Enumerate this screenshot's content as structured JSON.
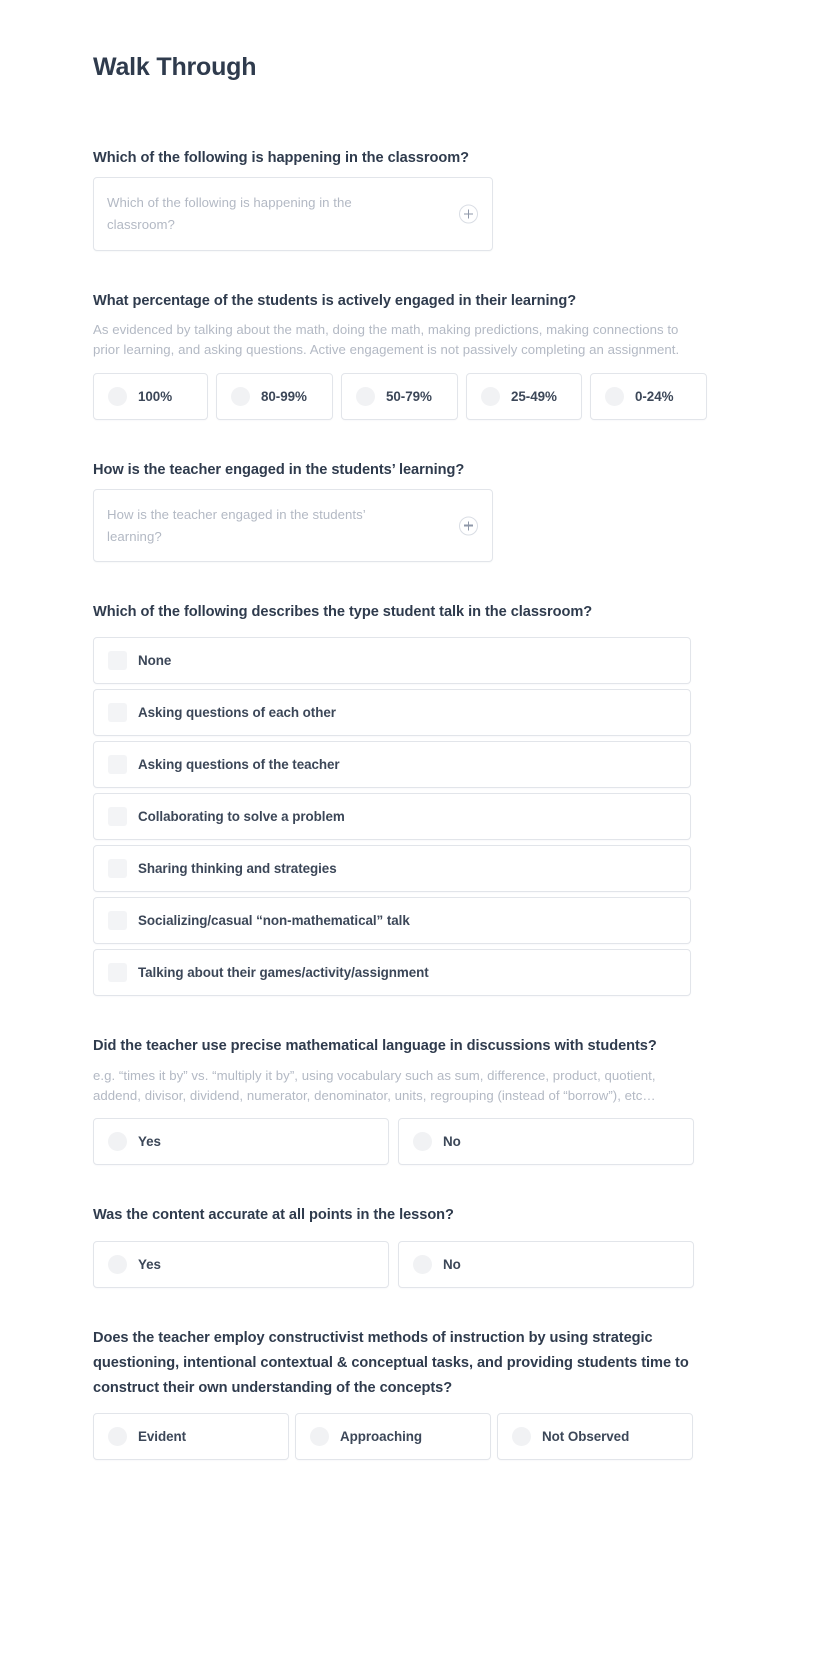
{
  "page": {
    "title": "Walk Through"
  },
  "questions": [
    {
      "id": "happening-in-classroom",
      "title": "Which of the following is happening in the classroom?",
      "type": "textarea",
      "placeholder": "Which of the following is happening in the classroom?",
      "add_icon": "plus-circle-icon"
    },
    {
      "id": "percentage-engaged",
      "title": "What percentage of the students is actively engaged in their learning?",
      "help": "As evidenced by talking about the math, doing the math, making predictions, making connections to prior learning, and asking questions. Active engagement is not passively completing an assignment.",
      "type": "radio-row",
      "options": [
        "100%",
        "80-99%",
        "50-79%",
        "25-49%",
        "0-24%"
      ]
    },
    {
      "id": "teacher-engaged",
      "title": "How is the teacher engaged in the students’ learning?",
      "type": "textarea",
      "placeholder": "How is the teacher engaged in the students’ learning?",
      "add_icon": "plus-circle-icon"
    },
    {
      "id": "student-talk-type",
      "title": "Which of the following describes the type student talk in the classroom?",
      "type": "checkbox-list",
      "options": [
        "None",
        "Asking questions of each other",
        "Asking questions of the teacher",
        "Collaborating to solve a problem",
        "Sharing thinking and strategies",
        "Socializing/casual “non-mathematical” talk",
        "Talking about their games/activity/assignment"
      ]
    },
    {
      "id": "precise-math-language",
      "title": "Did the teacher use precise mathematical language in discussions with students?",
      "help": "e.g. “times it by” vs. “multiply it by”, using vocabulary such as sum, difference, product, quotient, addend, divisor, dividend, numerator, denominator, units, regrouping (instead of “borrow”), etc…",
      "type": "radio-row",
      "options": [
        "Yes",
        "No"
      ]
    },
    {
      "id": "content-accurate",
      "title": "Was the content accurate at all points in the lesson?",
      "type": "radio-row",
      "options": [
        "Yes",
        "No"
      ]
    },
    {
      "id": "constructivist-methods",
      "title": "Does the teacher employ constructivist methods of instruction by using strategic questioning, intentional contextual & conceptual tasks, and providing students time to construct their own understanding of the concepts?",
      "type": "radio-row",
      "options": [
        "Evident",
        "Approaching",
        "Not Observed"
      ]
    }
  ],
  "colors": {
    "heading": "#2f3b4d",
    "label": "#3c4758",
    "muted": "#b3b9c4",
    "border": "#e2e5ea",
    "control_fill": "#f1f2f4",
    "background": "#ffffff"
  }
}
